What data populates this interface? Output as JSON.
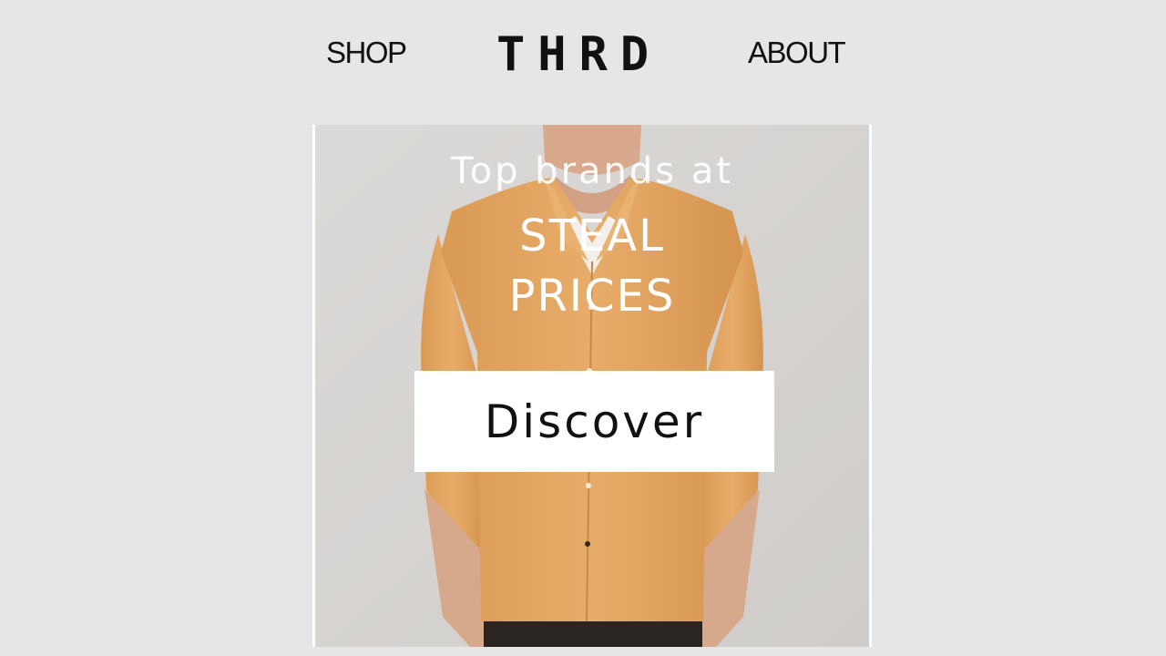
{
  "header": {
    "shop_label": "SHOP",
    "logo_text": "THRD",
    "about_label": "ABOUT"
  },
  "hero": {
    "line1": "Top brands at",
    "line2": "STEAL",
    "line3": "PRICES",
    "cta_label": "Discover"
  },
  "colors": {
    "page_background": "#e6e6e6",
    "text": "#111111",
    "shirt": "#e2a766",
    "button_background": "#ffffff"
  }
}
